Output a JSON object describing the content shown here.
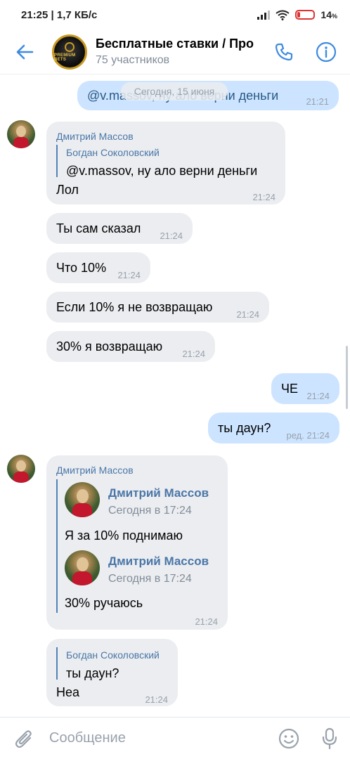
{
  "status_bar": {
    "time_speed": "21:25 | 1,7 КБ/с",
    "battery": "14",
    "battery_unit": "%"
  },
  "header": {
    "title": "Бесплатные ставки / Про",
    "subtitle": "75 участников",
    "avatar_text": "PREMIUM BETS"
  },
  "date_separator": "Сегодня, 15 июня",
  "messages": [
    {
      "direction": "out",
      "text": "@v.massov, ну ало верни деньги",
      "time": "21:21"
    },
    {
      "direction": "in",
      "sender": "Дмитрий Массов",
      "reply_to": {
        "name": "Богдан Соколовский",
        "text": "@v.massov, ну ало верни деньги"
      },
      "text": "Лол",
      "time": "21:24"
    },
    {
      "direction": "in",
      "text": "Ты сам сказал",
      "time": "21:24"
    },
    {
      "direction": "in",
      "text": "Что 10%",
      "time": "21:24"
    },
    {
      "direction": "in",
      "text": "Если 10% я не возвращаю",
      "time": "21:24"
    },
    {
      "direction": "in",
      "text": "30% я возвращаю",
      "time": "21:24"
    },
    {
      "direction": "out",
      "text": "ЧЕ",
      "time": "21:24"
    },
    {
      "direction": "out",
      "text": "ты даун?",
      "time": "ред. 21:24"
    },
    {
      "direction": "in",
      "sender": "Дмитрий Массов",
      "forwarded": [
        {
          "name": "Дмитрий Массов",
          "date": "Сегодня в 17:24",
          "text": "Я за 10% поднимаю"
        },
        {
          "name": "Дмитрий Массов",
          "date": "Сегодня в 17:24",
          "text": "30% ручаюсь"
        }
      ],
      "time": "21:24"
    },
    {
      "direction": "in",
      "reply_to": {
        "name": "Богдан Соколовский",
        "text": "ты даун?"
      },
      "text": "Неа",
      "time": "21:24"
    }
  ],
  "composer": {
    "placeholder": "Сообщение"
  },
  "colors": {
    "accent": "#4a76a8",
    "icon_blue": "#3f8ae0",
    "incoming_bubble": "#ebedf0",
    "outgoing_bubble": "#cce4ff",
    "battery_low": "#dd3333"
  },
  "icons": [
    "back-arrow-icon",
    "phone-icon",
    "info-icon",
    "attach-icon",
    "emoji-icon",
    "microphone-icon",
    "wifi-icon",
    "signal-icon",
    "battery-icon"
  ]
}
